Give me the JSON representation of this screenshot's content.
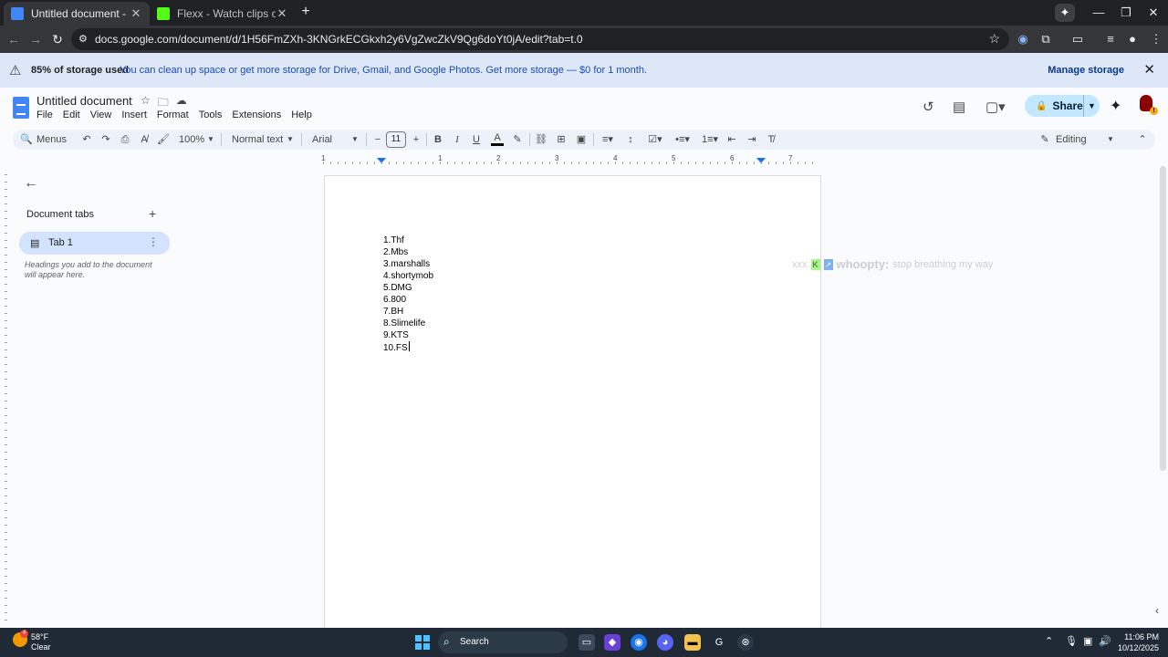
{
  "browser": {
    "tabs": [
      {
        "title": "Untitled document - Google Do",
        "active": true,
        "icon_color": "#4285f4"
      },
      {
        "title": "Flexx - Watch clips on Kick",
        "active": false,
        "icon_color": "#53fc18"
      }
    ],
    "url": "docs.google.com/document/d/1H56FmZXh-3KNGrkECGkxh2y6VgZwcZkV9Qg6doYt0jA/edit?tab=t.0"
  },
  "banner": {
    "bold": "85% of storage used",
    "message": "You can clean up space or get more storage for Drive, Gmail, and Google Photos. Get more storage — $0 for 1 month.",
    "action": "Manage storage"
  },
  "docs": {
    "title": "Untitled document",
    "menu": [
      "File",
      "Edit",
      "View",
      "Insert",
      "Format",
      "Tools",
      "Extensions",
      "Help"
    ],
    "share_label": "Share",
    "toolbar": {
      "search": "Menus",
      "zoom": "100%",
      "style": "Normal text",
      "font": "Arial",
      "size": "11",
      "mode": "Editing"
    },
    "ruler_numbers": [
      "1",
      "1",
      "2",
      "3",
      "4",
      "5",
      "6",
      "7"
    ],
    "sidebar": {
      "title": "Document tabs",
      "tab": "Tab 1",
      "hint": "Headings you add to the document will appear here."
    },
    "content": [
      "1.Thf",
      "2.Mbs",
      "3.marshalls",
      "4.shortymob",
      "5.DMG",
      "6.800",
      "7.BH",
      "8.Slimelife",
      "9.KTS",
      "10.FS"
    ]
  },
  "overlay": {
    "t1": "xxx",
    "t2": "whoopty:",
    "t3": "stop breathing my way"
  },
  "taskbar": {
    "temp": "58°F",
    "condition": "Clear",
    "weather_badge": "4",
    "search": "Search",
    "time": "11:06 PM",
    "date": "10/12/2025"
  },
  "colors": {
    "accent": "#1a73e8",
    "banner_bg": "#dde7f7",
    "share_bg": "#c2e7ff",
    "kick_green": "#53fc18"
  }
}
